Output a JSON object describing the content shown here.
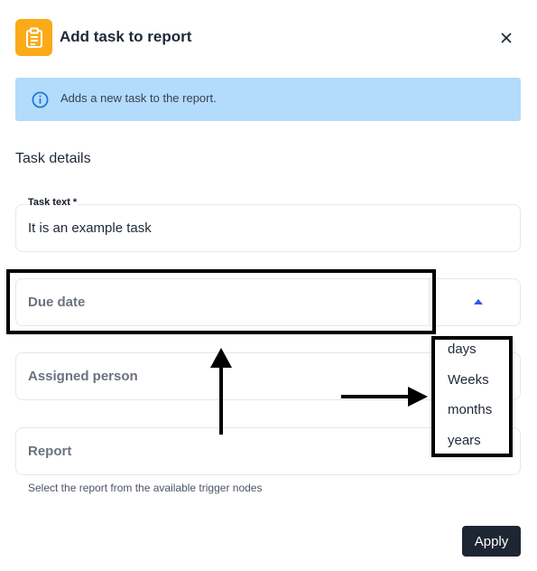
{
  "dialog": {
    "title": "Add task to report",
    "header_icon": "clipboard-icon",
    "close_icon": "close-icon"
  },
  "info_banner": {
    "icon": "info-icon",
    "text": "Adds a new task to the report."
  },
  "section": {
    "title": "Task details"
  },
  "fields": {
    "task_text": {
      "label": "Task text *",
      "value": "It is an example task"
    },
    "due_date": {
      "placeholder": "Due date",
      "unit_icon": "caret-up-icon",
      "unit_options": [
        "days",
        "Weeks",
        "months",
        "years"
      ]
    },
    "assigned_person": {
      "placeholder": "Assigned person"
    },
    "report": {
      "placeholder": "Report",
      "helper": "Select the report from the available trigger nodes"
    }
  },
  "footer": {
    "apply_label": "Apply"
  },
  "colors": {
    "header_icon_bg": "#fbab18",
    "info_banner_bg": "#b3dbfb",
    "info_icon": "#1976d2",
    "caret": "#2f58e6",
    "apply_bg": "#1e2533"
  }
}
